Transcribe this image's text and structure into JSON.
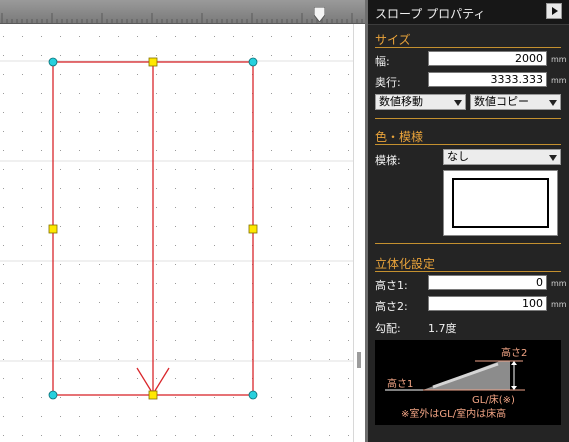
{
  "panel": {
    "title": "スロープ プロパティ",
    "size_section": "サイズ",
    "width_label": "幅:",
    "width_value": "2000",
    "depth_label": "奥行:",
    "depth_value": "3333.333",
    "unit_mm": "mm",
    "move_value_select": "数値移動",
    "copy_value_select": "数値コピー",
    "color_section": "色・模様",
    "pattern_label": "模様:",
    "pattern_value": "なし",
    "solid_section": "立体化設定",
    "height1_label": "高さ1:",
    "height1_value": "0",
    "height2_label": "高さ2:",
    "height2_value": "100",
    "slope_label": "勾配:",
    "slope_value": "1.7度",
    "diagram": {
      "height1": "高さ1",
      "height2": "高さ2",
      "gl_label": "GL/床(※)",
      "note": "※室外はGL/室内は床高"
    }
  },
  "colors": {
    "panel_bg": "#242424",
    "section_orange": "#e9a33a",
    "shape_red": "#d9262b",
    "handle_yellow": "#ffe800",
    "corner_cyan": "#27d0dd"
  }
}
